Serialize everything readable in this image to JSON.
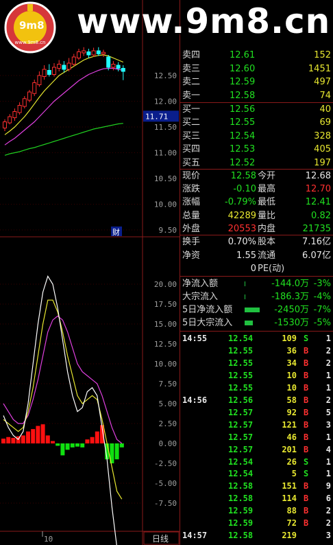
{
  "watermark": {
    "text": "www.9m8.cn",
    "logo_text": "9m8",
    "logo_sub": "www.9m8.cn"
  },
  "price_axis": [
    "12.50",
    "12.00",
    "11.50",
    "11.00",
    "10.50",
    "10.00",
    "9.50"
  ],
  "price_marker": "11.71",
  "finance_marker": "财",
  "indicator_axis": [
    "20.00",
    "17.50",
    "15.00",
    "12.50",
    "10.00",
    "7.50",
    "5.00",
    "2.50",
    "0.00",
    "-2.50",
    "-5.00",
    "-7.50"
  ],
  "x_label": "10",
  "period_button": "日线",
  "colors": {
    "up": "#ff3030",
    "down": "#20ffff",
    "ma_yellow": "#e8e830",
    "ma_magenta": "#e040e0",
    "ma_green": "#20d020",
    "line_white": "#ffffff"
  },
  "sell_book": [
    {
      "label": "卖四",
      "price": "12.61",
      "vol": "152"
    },
    {
      "label": "卖三",
      "price": "12.60",
      "vol": "1451"
    },
    {
      "label": "卖二",
      "price": "12.59",
      "vol": "497"
    },
    {
      "label": "卖一",
      "price": "12.58",
      "vol": "74"
    }
  ],
  "buy_book": [
    {
      "label": "买一",
      "price": "12.56",
      "vol": "40"
    },
    {
      "label": "买二",
      "price": "12.55",
      "vol": "69"
    },
    {
      "label": "买三",
      "price": "12.54",
      "vol": "328"
    },
    {
      "label": "买四",
      "price": "12.53",
      "vol": "405"
    },
    {
      "label": "买五",
      "price": "12.52",
      "vol": "197"
    }
  ],
  "quote": [
    {
      "l1": "现价",
      "v1": "12.58",
      "c1": "green",
      "l2": "今开",
      "v2": "12.68",
      "c2": "white"
    },
    {
      "l1": "涨跌",
      "v1": "-0.10",
      "c1": "green",
      "l2": "最高",
      "v2": "12.70",
      "c2": "red"
    },
    {
      "l1": "涨幅",
      "v1": "-0.79%",
      "c1": "green",
      "l2": "最低",
      "v2": "12.41",
      "c2": "green"
    },
    {
      "l1": "总量",
      "v1": "42289",
      "c1": "yellow",
      "l2": "量比",
      "v2": "0.82",
      "c2": "green"
    },
    {
      "l1": "外盘",
      "v1": "20553",
      "c1": "red",
      "l2": "内盘",
      "v2": "21735",
      "c2": "green"
    }
  ],
  "fund": [
    {
      "l1": "换手",
      "v1": "0.70%",
      "l2": "股本",
      "v2": "7.16亿"
    },
    {
      "l1": "净资",
      "v1": "1.55",
      "l2": "流通",
      "v2": "6.07亿"
    },
    {
      "l1": "",
      "v1": "0",
      "l2": "PE(动)",
      "v2": ""
    }
  ],
  "flows": [
    {
      "label": "净流入额",
      "value": "-144.0万",
      "pct": "-3%"
    },
    {
      "label": "大宗流入",
      "value": "-186.3万",
      "pct": "-4%"
    },
    {
      "label": "5日净流入额",
      "value": "-2450万",
      "pct": "-7%"
    },
    {
      "label": "5日大宗流入",
      "value": "-1530万",
      "pct": "-5%"
    }
  ],
  "ticks": [
    {
      "time": "14:55",
      "price": "12.54",
      "vol": "109",
      "side": "S",
      "n": "1"
    },
    {
      "time": "",
      "price": "12.55",
      "vol": "36",
      "side": "B",
      "n": "2"
    },
    {
      "time": "",
      "price": "12.55",
      "vol": "34",
      "side": "B",
      "n": "2"
    },
    {
      "time": "",
      "price": "12.55",
      "vol": "10",
      "side": "B",
      "n": "1"
    },
    {
      "time": "",
      "price": "12.55",
      "vol": "10",
      "side": "B",
      "n": "1"
    },
    {
      "time": "14:56",
      "price": "12.56",
      "vol": "58",
      "side": "B",
      "n": "2"
    },
    {
      "time": "",
      "price": "12.57",
      "vol": "92",
      "side": "B",
      "n": "5"
    },
    {
      "time": "",
      "price": "12.57",
      "vol": "121",
      "side": "B",
      "n": "3"
    },
    {
      "time": "",
      "price": "12.57",
      "vol": "46",
      "side": "B",
      "n": "1"
    },
    {
      "time": "",
      "price": "12.57",
      "vol": "201",
      "side": "B",
      "n": "4"
    },
    {
      "time": "",
      "price": "12.54",
      "vol": "26",
      "side": "S",
      "n": "1"
    },
    {
      "time": "",
      "price": "12.54",
      "vol": "5",
      "side": "S",
      "n": "1"
    },
    {
      "time": "",
      "price": "12.58",
      "vol": "151",
      "side": "B",
      "n": "9"
    },
    {
      "time": "",
      "price": "12.58",
      "vol": "114",
      "side": "B",
      "n": "6"
    },
    {
      "time": "",
      "price": "12.59",
      "vol": "88",
      "side": "B",
      "n": "2"
    },
    {
      "time": "",
      "price": "12.59",
      "vol": "72",
      "side": "B",
      "n": "2"
    },
    {
      "time": "14:57",
      "price": "12.58",
      "vol": "219",
      "side": "",
      "n": "3"
    }
  ],
  "candles": [
    {
      "o": 11.48,
      "c": 11.6,
      "h": 11.65,
      "l": 11.42
    },
    {
      "o": 11.58,
      "c": 11.7,
      "h": 11.75,
      "l": 11.55
    },
    {
      "o": 11.68,
      "c": 11.8,
      "h": 11.86,
      "l": 11.62
    },
    {
      "o": 11.78,
      "c": 11.92,
      "h": 11.98,
      "l": 11.74
    },
    {
      "o": 11.9,
      "c": 12.05,
      "h": 12.1,
      "l": 11.86
    },
    {
      "o": 12.02,
      "c": 12.18,
      "h": 12.22,
      "l": 11.98
    },
    {
      "o": 12.15,
      "c": 12.36,
      "h": 12.42,
      "l": 12.1
    },
    {
      "o": 12.32,
      "c": 12.5,
      "h": 12.58,
      "l": 12.28
    },
    {
      "o": 12.48,
      "c": 12.62,
      "h": 12.7,
      "l": 12.42
    },
    {
      "o": 12.6,
      "c": 12.52,
      "h": 12.72,
      "l": 12.48
    },
    {
      "o": 12.52,
      "c": 12.66,
      "h": 12.74,
      "l": 12.48
    },
    {
      "o": 12.64,
      "c": 12.72,
      "h": 12.8,
      "l": 12.58
    },
    {
      "o": 12.7,
      "c": 12.62,
      "h": 12.78,
      "l": 12.56
    },
    {
      "o": 12.62,
      "c": 12.74,
      "h": 12.84,
      "l": 12.58
    },
    {
      "o": 12.72,
      "c": 12.86,
      "h": 12.92,
      "l": 12.68
    },
    {
      "o": 12.84,
      "c": 12.96,
      "h": 13.02,
      "l": 12.8
    },
    {
      "o": 12.94,
      "c": 12.98,
      "h": 13.05,
      "l": 12.88
    },
    {
      "o": 12.96,
      "c": 12.9,
      "h": 13.02,
      "l": 12.84
    },
    {
      "o": 12.9,
      "c": 12.98,
      "h": 13.04,
      "l": 12.86
    },
    {
      "o": 12.98,
      "c": 12.92,
      "h": 13.05,
      "l": 12.88
    },
    {
      "o": 12.92,
      "c": 12.95,
      "h": 13.0,
      "l": 12.86
    },
    {
      "o": 12.86,
      "c": 12.66,
      "h": 12.9,
      "l": 12.6
    },
    {
      "o": 12.66,
      "c": 12.72,
      "h": 12.78,
      "l": 12.6
    },
    {
      "o": 12.7,
      "c": 12.64,
      "h": 12.76,
      "l": 12.58
    },
    {
      "o": 12.64,
      "c": 12.58,
      "h": 12.7,
      "l": 12.41
    }
  ],
  "ma_yellow": [
    11.35,
    11.42,
    11.5,
    11.6,
    11.7,
    11.82,
    11.95,
    12.08,
    12.2,
    12.3,
    12.4,
    12.5,
    12.56,
    12.62,
    12.68,
    12.74,
    12.8,
    12.84,
    12.87,
    12.89,
    12.9,
    12.88,
    12.84,
    12.8,
    12.76
  ],
  "ma_magenta": [
    11.15,
    11.22,
    11.28,
    11.36,
    11.44,
    11.52,
    11.6,
    11.7,
    11.8,
    11.9,
    12.0,
    12.08,
    12.16,
    12.24,
    12.32,
    12.4,
    12.46,
    12.52,
    12.56,
    12.6,
    12.63,
    12.64,
    12.64,
    12.62,
    12.6
  ],
  "ma_green": [
    10.95,
    10.98,
    11.0,
    11.02,
    11.05,
    11.08,
    11.1,
    11.13,
    11.16,
    11.19,
    11.22,
    11.25,
    11.28,
    11.31,
    11.34,
    11.37,
    11.4,
    11.43,
    11.46,
    11.48,
    11.5,
    11.52,
    11.54,
    11.56,
    11.57
  ],
  "ind_white": [
    3.5,
    2.0,
    1.0,
    0.5,
    1.5,
    5.0,
    10.0,
    15.0,
    19.0,
    21.0,
    20.0,
    17.0,
    13.0,
    9.0,
    6.0,
    4.0,
    4.5,
    6.5,
    7.0,
    6.0,
    2.0,
    -2.0,
    -8.0,
    -13.0,
    -14.5
  ],
  "ind_yellow": [
    3.0,
    2.5,
    2.0,
    1.5,
    2.0,
    4.0,
    7.0,
    11.0,
    15.0,
    18.0,
    18.0,
    16.5,
    14.0,
    11.0,
    8.5,
    6.0,
    5.0,
    5.5,
    6.0,
    5.5,
    3.0,
    0.0,
    -3.0,
    -6.0,
    -7.0
  ],
  "ind_magenta": [
    5.0,
    4.0,
    3.0,
    2.5,
    2.5,
    3.5,
    5.5,
    8.0,
    11.0,
    14.0,
    15.5,
    16.0,
    15.5,
    14.0,
    12.0,
    10.0,
    9.0,
    8.5,
    8.0,
    7.5,
    6.0,
    4.0,
    2.0,
    0.5,
    0.0
  ],
  "ind_bars": [
    0.6,
    0.8,
    0.7,
    0.9,
    1.0,
    1.5,
    1.8,
    2.2,
    2.4,
    1.0,
    0.3,
    -0.3,
    -1.5,
    -0.8,
    -0.5,
    -0.4,
    -0.5,
    0.5,
    0.8,
    1.5,
    2.3,
    -2.0,
    -2.5,
    -2.0,
    -0.5
  ]
}
